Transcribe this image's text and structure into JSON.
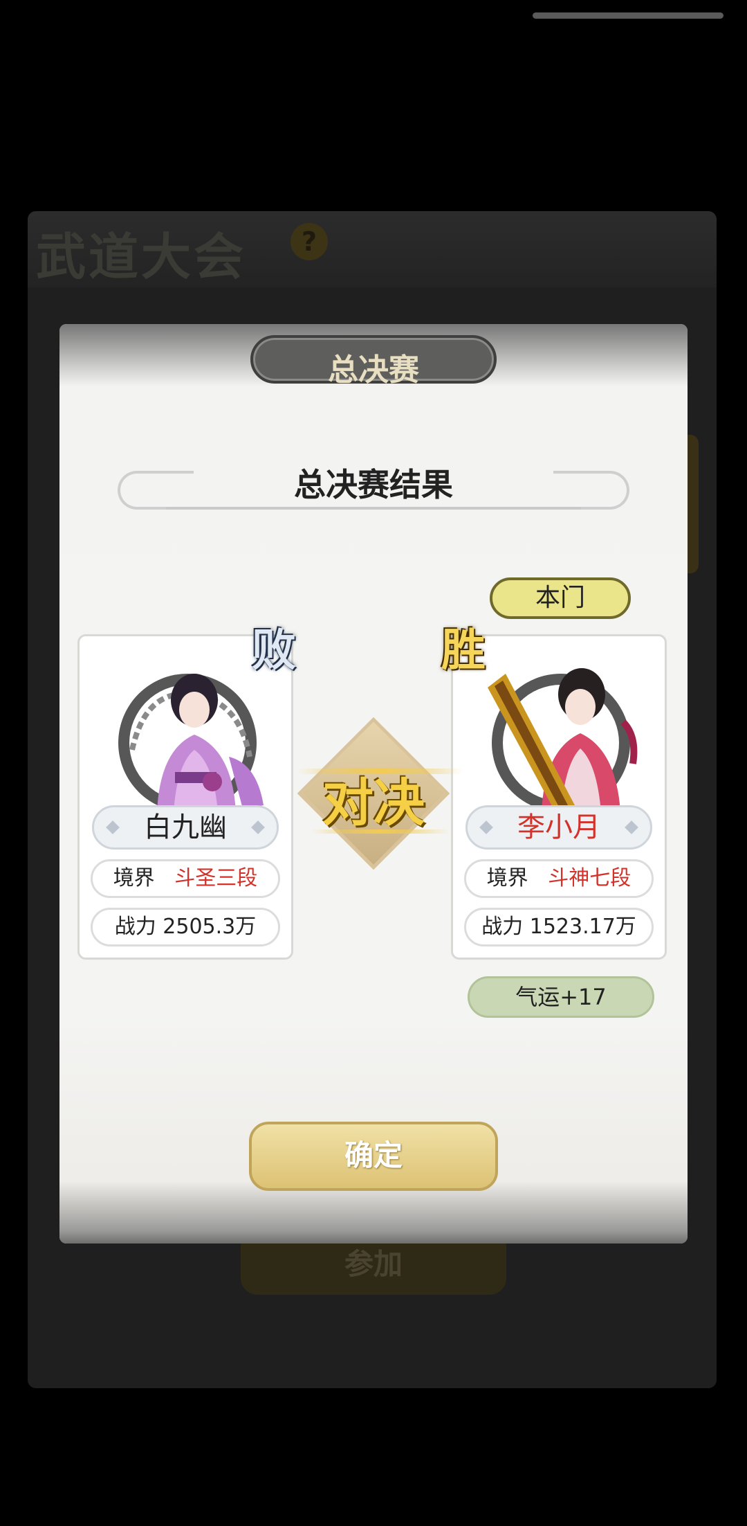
{
  "background": {
    "title": "武道大会",
    "help_icon": "?",
    "join_button": "参加"
  },
  "modal": {
    "header": "总决赛",
    "subtitle": "总决赛结果",
    "versus_label": "对决",
    "loser": {
      "badge": "败",
      "name": "白九幽",
      "realm_label": "境界",
      "realm_value": "斗圣三段",
      "power_label": "战力",
      "power_value": "2505.3万"
    },
    "winner": {
      "badge": "胜",
      "sect_tag": "本门",
      "name": "李小月",
      "realm_label": "境界",
      "realm_value": "斗神七段",
      "power_label": "战力",
      "power_value": "1523.17万",
      "reward": "气运+17"
    },
    "confirm_button": "确定"
  },
  "colors": {
    "accent_gold": "#f5cf45",
    "realm_red": "#d2322a",
    "sect_tag_bg": "#eae58a",
    "reward_bg": "#c9d7b4"
  }
}
